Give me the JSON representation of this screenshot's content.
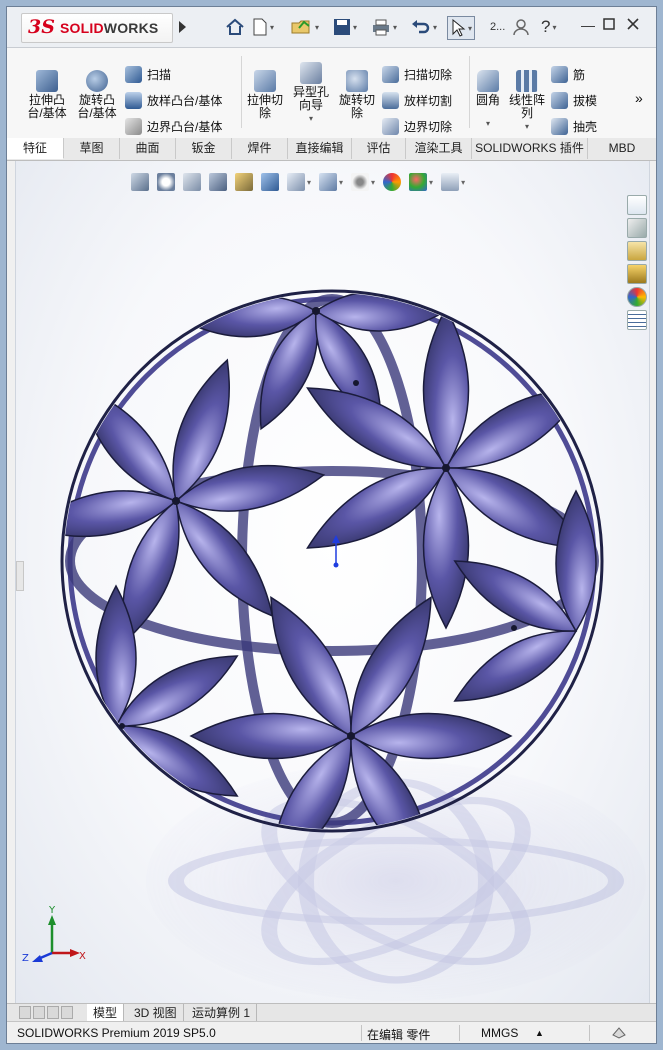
{
  "app": {
    "logo_ds": "3S",
    "logo_solid": "SOLID",
    "logo_works": "WORKS",
    "help_label": "?",
    "search_label": "2..."
  },
  "ribbon": {
    "extrude_boss": "拉伸凸台/基体",
    "revolve_boss": "旋转凸台/基体",
    "sweep": "扫描",
    "loft_boss": "放样凸台/基体",
    "boundary_boss": "边界凸台/基体",
    "extrude_cut": "拉伸切除",
    "hole_wizard": "异型孔向导",
    "revolve_cut": "旋转切除",
    "sweep_cut": "扫描切除",
    "loft_cut": "放样切割",
    "boundary_cut": "边界切除",
    "fillet": "圆角",
    "linear_pattern": "线性阵列",
    "rib": "筋",
    "draft": "拔模",
    "shell": "抽壳",
    "more": "»"
  },
  "tabs": [
    "特征",
    "草图",
    "曲面",
    "钣金",
    "焊件",
    "直接编辑",
    "评估",
    "渲染工具",
    "SOLIDWORKS 插件",
    "MBD"
  ],
  "active_tab": 0,
  "model_tabs": [
    "模型",
    "3D 视图",
    "运动算例 1"
  ],
  "status": {
    "product": "SOLIDWORKS Premium 2019 SP5.0",
    "mode": "在编辑 零件",
    "units": "MMGS",
    "units_arrow": "▲"
  },
  "triad": {
    "y": "Y",
    "z": "Z",
    "x": "X"
  },
  "colors": {
    "sphere_blue": "#5a56a6",
    "sphere_dark": "#262850",
    "brand_red": "#d6001c"
  }
}
